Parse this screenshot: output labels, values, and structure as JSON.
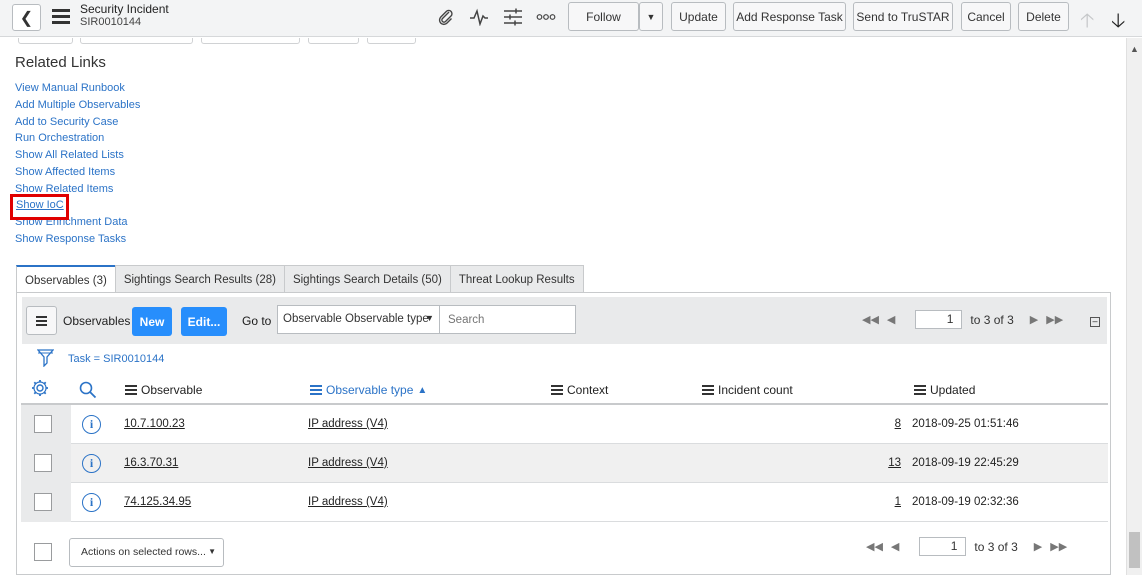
{
  "header": {
    "title": "Security Incident",
    "number": "SIR0010144",
    "buttons": {
      "follow": "Follow",
      "update": "Update",
      "add_response_task": "Add Response Task",
      "send_trustar": "Send to TruSTAR",
      "cancel": "Cancel",
      "delete": "Delete"
    }
  },
  "related_links": {
    "title": "Related Links",
    "items": [
      "View Manual Runbook",
      "Add Multiple Observables",
      "Add to Security Case",
      "Run Orchestration",
      "Show All Related Lists",
      "Show Affected Items",
      "Show Related Items",
      "Show IoC",
      "Show Enrichment Data",
      "Show Response Tasks"
    ]
  },
  "tabs": [
    "Observables (3)",
    "Sightings Search Results (28)",
    "Sightings Search Details (50)",
    "Threat Lookup Results"
  ],
  "list": {
    "title": "Observables",
    "new_label": "New",
    "edit_label": "Edit...",
    "goto_label": "Go to",
    "goto_field": "Observable Observable type",
    "search_placeholder": "Search",
    "page": "1",
    "page_range": "to 3 of 3",
    "filter": "Task = SIR0010144",
    "columns": [
      "Observable",
      "Observable type",
      "Context",
      "Incident count",
      "Updated"
    ],
    "sort_indicator": "▲",
    "rows": [
      {
        "observable": "10.7.100.23",
        "type": "IP address (V4)",
        "count": "8",
        "updated": "2018-09-25 01:51:46"
      },
      {
        "observable": "16.3.70.31",
        "type": "IP address (V4)",
        "count": "13",
        "updated": "2018-09-19 22:45:29"
      },
      {
        "observable": "74.125.34.95",
        "type": "IP address (V4)",
        "count": "1",
        "updated": "2018-09-19 02:32:36"
      }
    ],
    "actions_label": "Actions on selected rows..."
  },
  "colors": {
    "accent": "#2b73c7",
    "primary_button": "#278efc",
    "highlight": "#e00000"
  },
  "icons": [
    "back-icon",
    "hamburger-icon",
    "paperclip-icon",
    "activity-icon",
    "settings-sliders-icon",
    "more-icon",
    "chevron-down-icon",
    "arrow-up-icon",
    "arrow-down-icon",
    "gear-icon",
    "search-icon",
    "filter-icon",
    "info-icon"
  ]
}
